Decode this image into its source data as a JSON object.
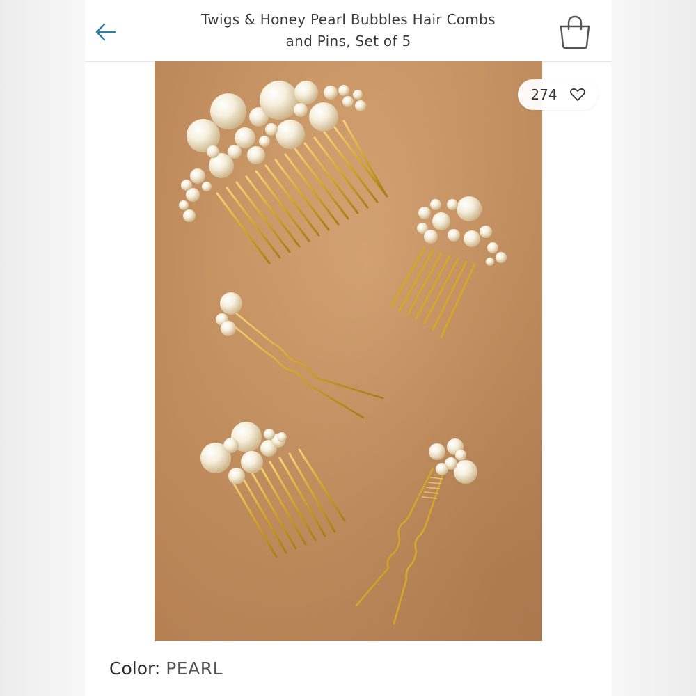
{
  "header": {
    "title_line1": "Twigs & Honey Pearl Bubbles Hair Combs",
    "title_line2": "and Pins, Set of 5"
  },
  "icons": {
    "back": "arrow-left-icon",
    "bag": "shopping-bag-icon",
    "like": "heart-icon"
  },
  "colors": {
    "accent": "#2a7fa6",
    "photo_bg": "#c89565",
    "gold": "#d4a62a",
    "pearl": "#f6efdc"
  },
  "product": {
    "likes": "274",
    "color_label": "Color:",
    "color_value": "PEARL",
    "image_alt": "Pearl hair combs and pins"
  }
}
